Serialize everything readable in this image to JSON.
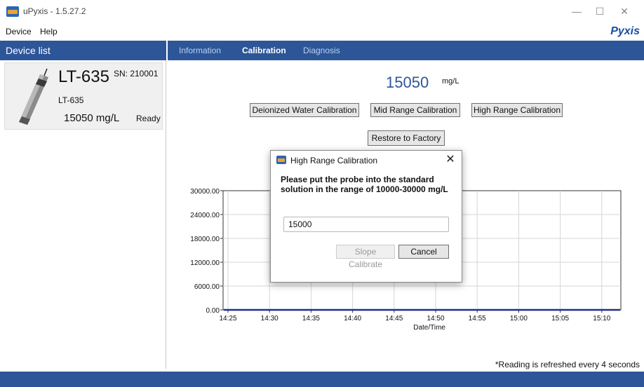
{
  "window": {
    "title": "uPyxis - 1.5.27.2",
    "minimize": "—",
    "maximize": "☐",
    "close": "✕"
  },
  "menu": {
    "items": [
      "Device",
      "Help"
    ],
    "brand": "Pyxis"
  },
  "device_list": {
    "header": "Device list",
    "device": {
      "name": "LT-635",
      "serial": "SN: 210001",
      "model": "LT-635",
      "reading": "15050 mg/L",
      "status": "Ready"
    }
  },
  "tabs": [
    {
      "label": "Information",
      "active": false
    },
    {
      "label": "Calibration",
      "active": true
    },
    {
      "label": "Diagnosis",
      "active": false
    }
  ],
  "calibration": {
    "reading_value": "15050",
    "reading_unit": "mg/L",
    "buttons": {
      "deionized": "Deionized Water Calibration",
      "mid": "Mid Range Calibration",
      "high": "High Range Calibration",
      "restore": "Restore to Factory"
    }
  },
  "chart_data": {
    "type": "line",
    "xlabel": "Date/Time",
    "ylabel": "",
    "x_ticks": [
      "14:25",
      "14:30",
      "14:35",
      "14:40",
      "14:45",
      "14:50",
      "14:55",
      "15:00",
      "15:05",
      "15:10"
    ],
    "y_ticks": [
      "0.00",
      "6000.00",
      "12000.00",
      "18000.00",
      "24000.00",
      "30000.00"
    ],
    "ylim": [
      0,
      30000
    ],
    "grid": true,
    "series": [
      {
        "values": [
          0,
          0,
          0,
          0,
          0,
          0,
          0,
          0,
          0,
          0,
          0
        ]
      }
    ],
    "line_color": "#1f2f8a"
  },
  "footnote": "*Reading is refreshed every 4 seconds",
  "dialog": {
    "title": "High Range Calibration",
    "message": "Please put the probe into the standard solution in the range of 10000-30000 mg/L",
    "input_value": "15000",
    "slope_button": "Slope Calibrate",
    "cancel_button": "Cancel",
    "close": "✕"
  }
}
